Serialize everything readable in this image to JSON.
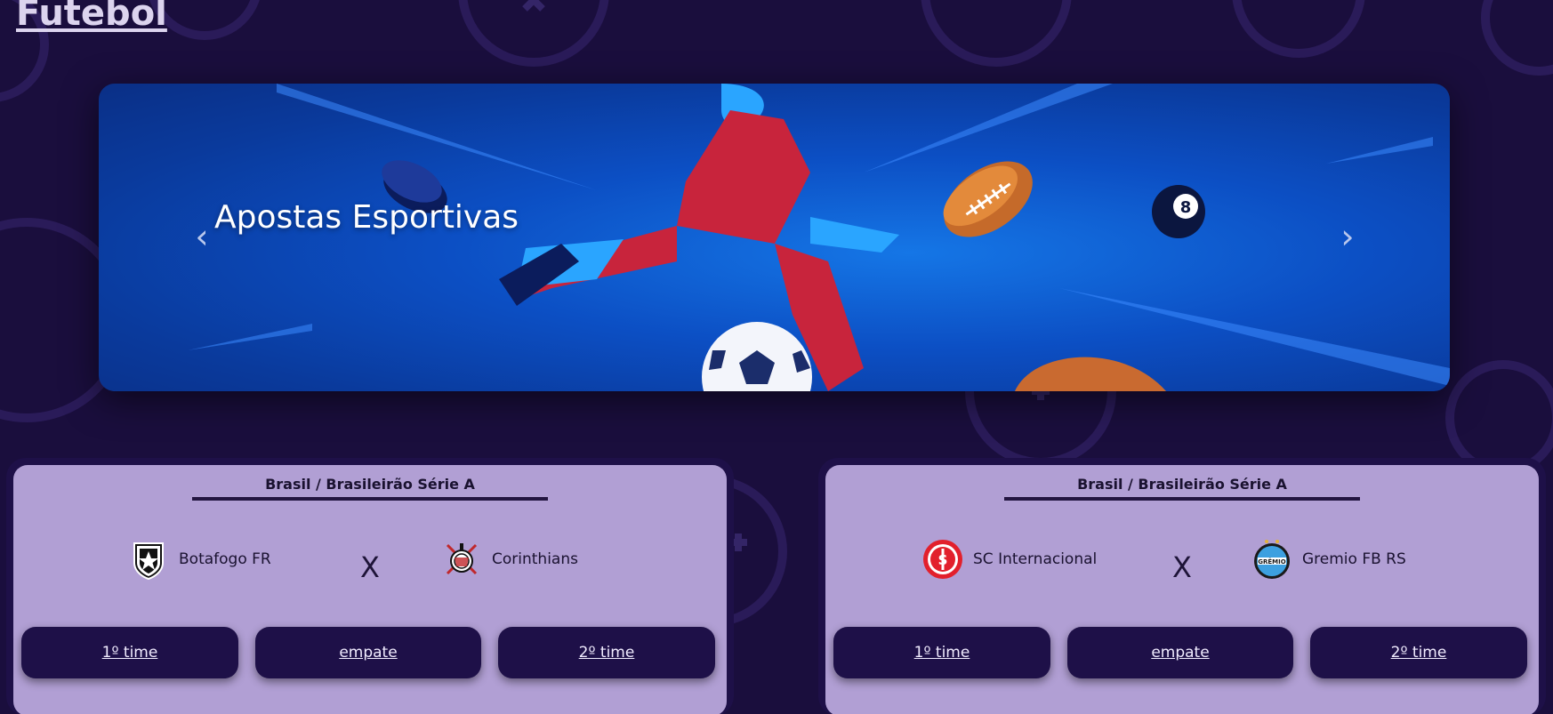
{
  "page": {
    "title": "Futebol"
  },
  "banner": {
    "caption": "Apostas Esportivas",
    "prev_icon": "‹",
    "next_icon": "›"
  },
  "matches": [
    {
      "league": "Brasil / Brasileirão Série A",
      "home": {
        "name": "Botafogo FR",
        "icon": "botafogo-crest-icon"
      },
      "away": {
        "name": "Corinthians",
        "icon": "corinthians-crest-icon"
      },
      "versus": "X",
      "buttons": {
        "home": "1º time",
        "draw": "empate",
        "away": "2º time"
      }
    },
    {
      "league": "Brasil / Brasileirão Série A",
      "home": {
        "name": "SC Internacional",
        "icon": "internacional-crest-icon"
      },
      "away": {
        "name": "Gremio FB RS",
        "icon": "gremio-crest-icon"
      },
      "versus": "X",
      "buttons": {
        "home": "1º time",
        "draw": "empate",
        "away": "2º time"
      }
    }
  ],
  "colors": {
    "background": "#1a0e3d",
    "card": "#b19fd4",
    "button": "#1e1048",
    "banner": "#0c4fc4"
  }
}
